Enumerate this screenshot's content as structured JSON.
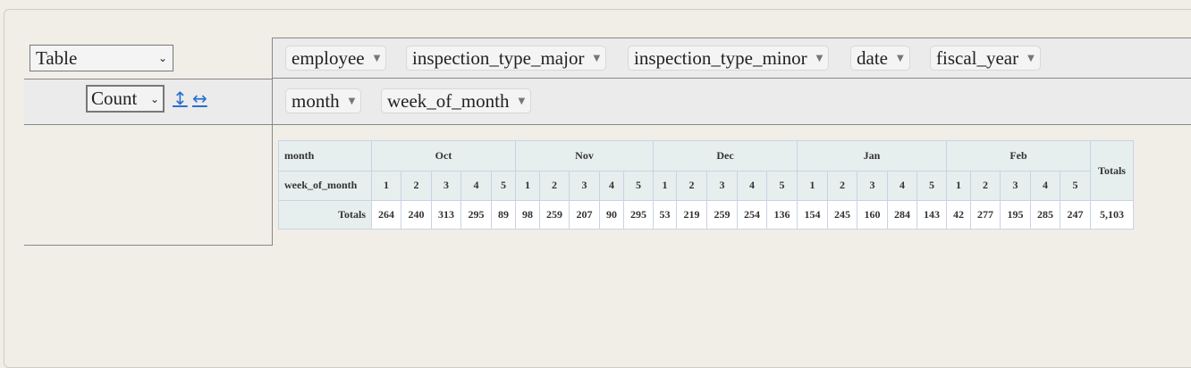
{
  "renderer": {
    "selected": "Table"
  },
  "aggregator": {
    "selected": "Count",
    "row_sort_icon": "↕",
    "col_sort_icon": "↔"
  },
  "unused_attrs": [
    "employee",
    "inspection_type_major",
    "inspection_type_minor",
    "date",
    "fiscal_year"
  ],
  "col_attrs": [
    "month",
    "week_of_month"
  ],
  "pivot": {
    "header_month": "month",
    "header_week": "week_of_month",
    "totals_label": "Totals",
    "col_totals_header": "Totals",
    "months": [
      "Oct",
      "Nov",
      "Dec",
      "Jan",
      "Feb"
    ],
    "weeks": [
      "1",
      "2",
      "3",
      "4",
      "5",
      "1",
      "2",
      "3",
      "4",
      "5",
      "1",
      "2",
      "3",
      "4",
      "5",
      "1",
      "2",
      "3",
      "4",
      "5",
      "1",
      "2",
      "3",
      "4",
      "5"
    ],
    "totals": [
      "264",
      "240",
      "313",
      "295",
      "89",
      "98",
      "259",
      "207",
      "90",
      "295",
      "53",
      "219",
      "259",
      "254",
      "136",
      "154",
      "245",
      "160",
      "284",
      "143",
      "42",
      "277",
      "195",
      "285",
      "247"
    ],
    "grand_total": "5,103"
  }
}
